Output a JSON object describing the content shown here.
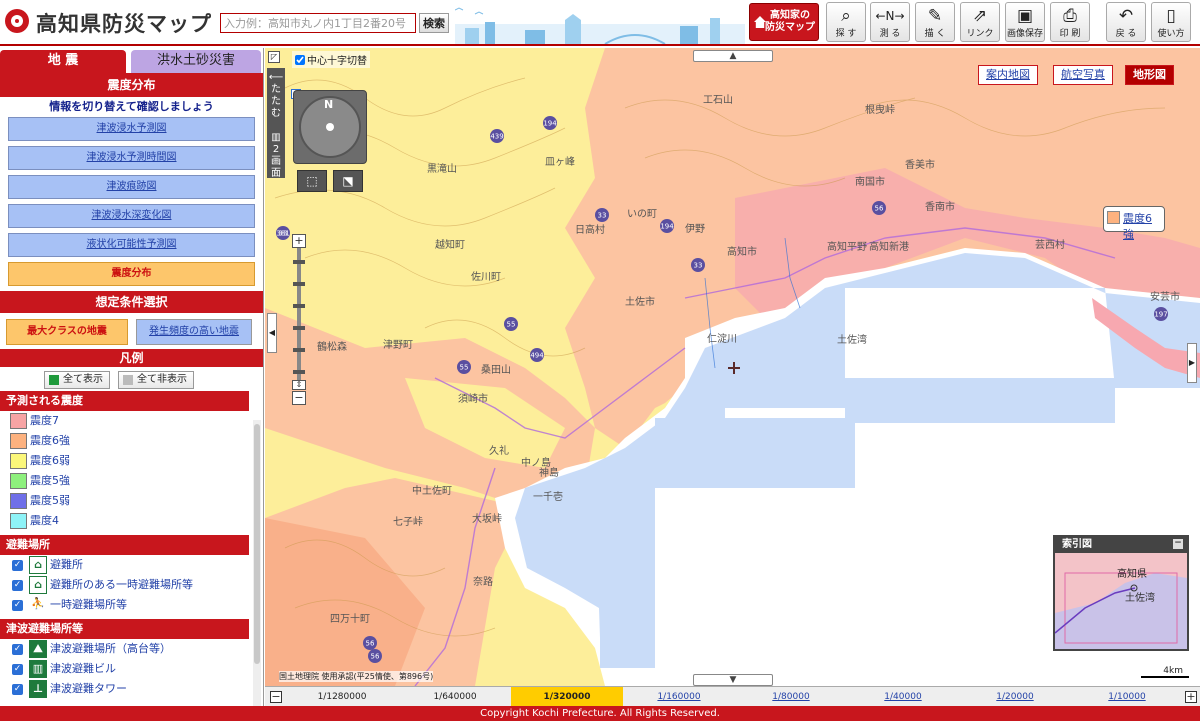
{
  "header": {
    "title": "高知県防災マップ",
    "search_placeholder": "入力例：高知市丸ノ内1丁目2番20号",
    "search_button": "検索",
    "home_button_line1": "高知家の",
    "home_button_line2": "防災マップ",
    "tools": [
      {
        "label": "探 す",
        "icon": "magnifier-icon"
      },
      {
        "label": "測 る",
        "icon": "ruler-icon"
      },
      {
        "label": "描 く",
        "icon": "palette-icon"
      },
      {
        "label": "リンク",
        "icon": "link-icon"
      },
      {
        "label": "画像保存",
        "icon": "image-save-icon"
      },
      {
        "label": "印 刷",
        "icon": "printer-icon"
      },
      {
        "label": "戻 る",
        "icon": "undo-icon"
      },
      {
        "label": "使い方",
        "icon": "mouse-icon"
      }
    ]
  },
  "sidebar": {
    "tabs": [
      {
        "label": "地 震",
        "active": true
      },
      {
        "label": "洪水土砂災害",
        "active": false
      }
    ],
    "section_title": "震度分布",
    "instruction": "情報を切り替えて確認しましょう",
    "layers": [
      {
        "label": "津波浸水予測図",
        "active": false
      },
      {
        "label": "津波浸水予測時間図",
        "active": false
      },
      {
        "label": "津波痕跡図",
        "active": false
      },
      {
        "label": "津波浸水深変化図",
        "active": false
      },
      {
        "label": "液状化可能性予測図",
        "active": false
      },
      {
        "label": "震度分布",
        "active": true
      }
    ],
    "conditions_title": "想定条件選択",
    "conditions": [
      {
        "label": "最大クラスの地震",
        "selected": true
      },
      {
        "label": "発生頻度の高い地震",
        "selected": false
      }
    ],
    "legend_title": "凡例",
    "show_all": "全て表示",
    "hide_all": "全て非表示",
    "intensity_title": "予測される震度",
    "intensity_levels": [
      {
        "label": "震度7",
        "color": "#f7a4a4"
      },
      {
        "label": "震度6強",
        "color": "#fdb27f"
      },
      {
        "label": "震度6弱",
        "color": "#fbf77a"
      },
      {
        "label": "震度5強",
        "color": "#8ef07d"
      },
      {
        "label": "震度5弱",
        "color": "#6f6fe8"
      },
      {
        "label": "震度4",
        "color": "#8ef3f7"
      }
    ],
    "shelter_title": "避難場所",
    "shelters": [
      {
        "label": "避難所",
        "checked": true,
        "icon": "shelter-icon"
      },
      {
        "label": "避難所のある一時避難場所等",
        "checked": true,
        "icon": "shelter-with-temp-icon"
      },
      {
        "label": "一時避難場所等",
        "checked": true,
        "icon": "temporary-evacuation-icon"
      }
    ],
    "tsunami_title": "津波避難場所等",
    "tsunami_items": [
      {
        "label": "津波避難場所（高台等）",
        "checked": true,
        "icon": "tsunami-highground-icon"
      },
      {
        "label": "津波避難ビル",
        "checked": true,
        "icon": "tsunami-building-icon"
      },
      {
        "label": "津波避難タワー",
        "checked": true,
        "icon": "tsunami-tower-icon"
      }
    ]
  },
  "map": {
    "crosshair_toggle": "中心十字切替",
    "fold_label": "たたむ",
    "split_label": "2画面",
    "compass_north": "N",
    "map_types": [
      {
        "label": "案内地図",
        "active": false
      },
      {
        "label": "航空写真",
        "active": false
      },
      {
        "label": "地形図",
        "active": true
      }
    ],
    "callout_label": "震度6強",
    "overview_title": "索引図",
    "overview_labels": [
      "高知県",
      "土佐湾"
    ],
    "scale_label": "4km",
    "attribution": "国土地理院 使用承認(平25情使、第896号)",
    "place_labels": [
      "工石山",
      "根曳峠",
      "黒滝山",
      "皿ヶ峰",
      "いの町",
      "日高村",
      "伊野",
      "香美市",
      "南国市",
      "香南市",
      "芸西村",
      "高知市",
      "高知平野",
      "高知新港",
      "安芸市",
      "土佐市",
      "土佐湾",
      "越知町",
      "佐川町",
      "須崎市",
      "中土佐町",
      "七子峠",
      "四万十町",
      "津野町",
      "鶴松森",
      "桑田山",
      "一千壱",
      "中ノ島",
      "神島",
      "大坂峠",
      "久礼",
      "奈路",
      "仁淀川"
    ],
    "route_numbers": [
      "194",
      "439",
      "33",
      "194",
      "33",
      "56",
      "55",
      "55",
      "494",
      "197",
      "56",
      "381",
      "56",
      "33"
    ]
  },
  "scale_stops": [
    {
      "label": "1/1280000",
      "link": false,
      "current": false
    },
    {
      "label": "1/640000",
      "link": false,
      "current": false
    },
    {
      "label": "1/320000",
      "link": false,
      "current": true
    },
    {
      "label": "1/160000",
      "link": true,
      "current": false
    },
    {
      "label": "1/80000",
      "link": true,
      "current": false
    },
    {
      "label": "1/40000",
      "link": true,
      "current": false
    },
    {
      "label": "1/20000",
      "link": true,
      "current": false
    },
    {
      "label": "1/10000",
      "link": true,
      "current": false
    }
  ],
  "footer": "Copyright Kochi Prefecture. All Rights Reserved."
}
